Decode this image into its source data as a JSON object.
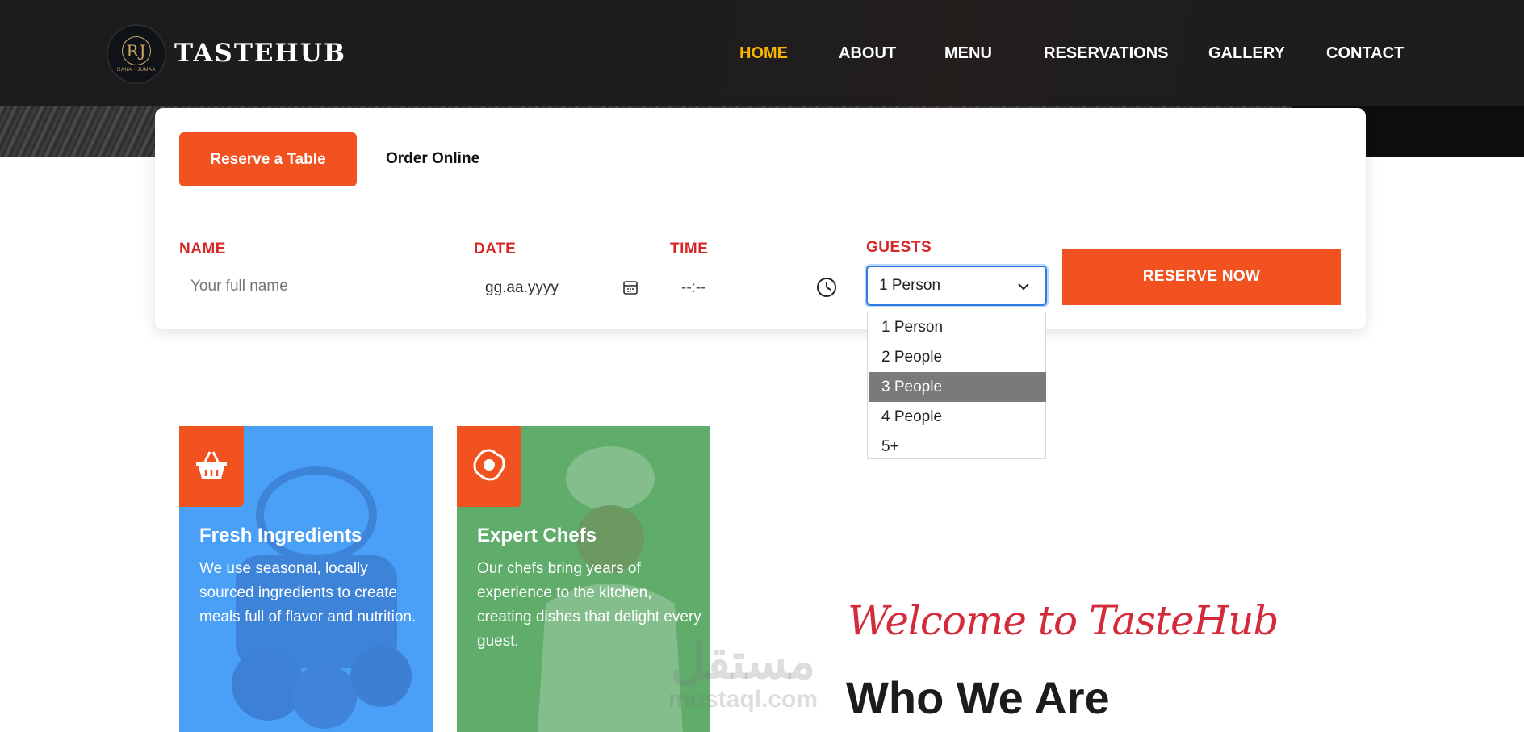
{
  "brand": {
    "name": "TASTEHUB",
    "logo_monogram": "RJ",
    "logo_subtext": "RANA · JUMAA"
  },
  "nav": {
    "items": [
      {
        "label": "HOME",
        "active": true
      },
      {
        "label": "ABOUT",
        "active": false
      },
      {
        "label": "MENU",
        "active": false
      },
      {
        "label": "RESERVATIONS",
        "active": false
      },
      {
        "label": "GALLERY",
        "active": false
      },
      {
        "label": "CONTACT",
        "active": false
      }
    ]
  },
  "reservation": {
    "tabs": {
      "active": "Reserve a Table",
      "other": "Order Online"
    },
    "name": {
      "label": "NAME",
      "placeholder": "Your full name",
      "value": ""
    },
    "date": {
      "label": "DATE",
      "value": "gg.aa.yyyy"
    },
    "time": {
      "label": "TIME",
      "value": "--:--"
    },
    "guests": {
      "label": "GUESTS",
      "selected": "1 Person",
      "options": [
        "1 Person",
        "2 People",
        "3 People",
        "4 People",
        "5+"
      ],
      "highlighted": "3 People"
    },
    "submit_label": "RESERVE NOW"
  },
  "features": [
    {
      "title": "Fresh Ingredients",
      "description": "We use seasonal, locally sourced ingredients to create meals full of flavor and nutrition.",
      "icon": "basket-icon"
    },
    {
      "title": "Expert Chefs",
      "description": "Our chefs bring years of experience to the kitchen, creating dishes that delight every guest.",
      "icon": "flower-icon"
    }
  ],
  "about": {
    "welcome": "Welcome to TasteHub",
    "heading": "Who We Are"
  },
  "watermark": {
    "arabic": "مستقل",
    "latin": "mostaql.com"
  },
  "colors": {
    "accent": "#f25120",
    "nav_active": "#f7b500",
    "label_red": "#d42828",
    "feature_blue": "#4a9ff7",
    "feature_green": "#5fac6b",
    "welcome_red": "#d42b3c"
  }
}
